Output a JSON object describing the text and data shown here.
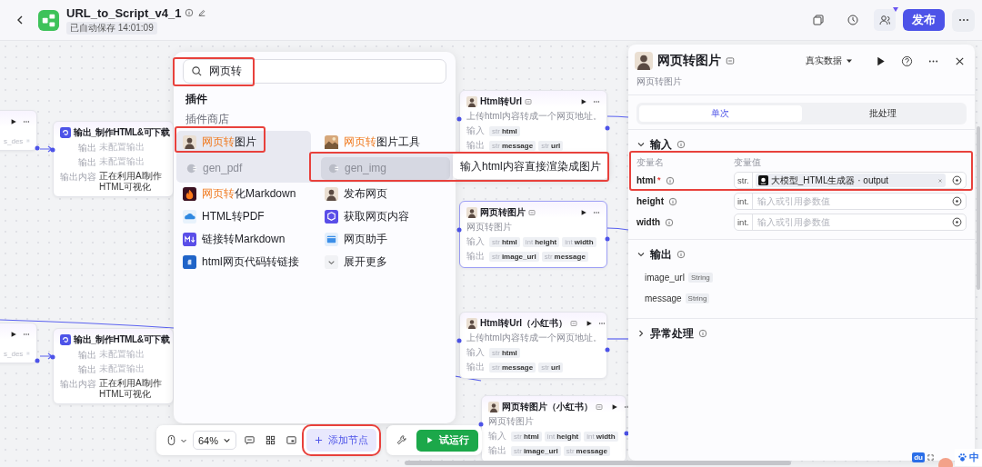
{
  "header": {
    "title": "URL_to_Script_v4_1",
    "save_status": "已自动保存 14:01:09",
    "publish_button": "发布",
    "collab_badge": true
  },
  "canvas": {
    "nodes": [
      {
        "kind": "stub",
        "field": "s_des",
        "selected": false
      },
      {
        "kind": "output",
        "title": "输出_制作HTML&可下载",
        "selected": false,
        "rows": [
          {
            "label": "输出",
            "value": "未配置输出",
            "configured": false
          },
          {
            "label": "输出",
            "value": "未配置输出",
            "configured": false
          },
          {
            "label": "输出内容",
            "value": "正在利用AI制作HTML可视化",
            "configured": true
          }
        ]
      },
      {
        "kind": "stub",
        "field": "s_des",
        "selected": false
      },
      {
        "kind": "output",
        "title": "输出_制作HTML&可下载",
        "selected": false,
        "rows": [
          {
            "label": "输出",
            "value": "未配置输出",
            "configured": false
          },
          {
            "label": "输出",
            "value": "未配置输出",
            "configured": false
          },
          {
            "label": "输出内容",
            "value": "正在利用AI制作HTML可视化",
            "configured": true
          }
        ]
      },
      {
        "kind": "plugin",
        "title": "Html转Url",
        "description": "上传html内容转成一个网页地址。",
        "selected": false,
        "input_label": "输入",
        "output_label": "输出",
        "inputs": [
          {
            "type": "str",
            "name": "html"
          }
        ],
        "outputs": [
          {
            "type": "str",
            "name": "message"
          },
          {
            "type": "str",
            "name": "url"
          }
        ]
      },
      {
        "kind": "plugin",
        "title": "网页转图片",
        "description": "网页转图片",
        "selected": true,
        "input_label": "输入",
        "output_label": "输出",
        "inputs": [
          {
            "type": "str",
            "name": "html"
          },
          {
            "type": "int",
            "name": "height"
          },
          {
            "type": "int",
            "name": "width"
          }
        ],
        "outputs": [
          {
            "type": "str",
            "name": "image_url"
          },
          {
            "type": "str",
            "name": "message"
          }
        ]
      },
      {
        "kind": "plugin",
        "title": "Html转Url（小红书）",
        "description": "上传html内容转成一个网页地址。",
        "selected": false,
        "input_label": "输入",
        "output_label": "输出",
        "inputs": [
          {
            "type": "str",
            "name": "html"
          }
        ],
        "outputs": [
          {
            "type": "str",
            "name": "message"
          },
          {
            "type": "str",
            "name": "url"
          }
        ]
      },
      {
        "kind": "plugin",
        "title": "网页转图片（小红书）",
        "description": "网页转图片",
        "selected": false,
        "input_label": "输入",
        "output_label": "输出",
        "inputs": [
          {
            "type": "str",
            "name": "html"
          },
          {
            "type": "int",
            "name": "height"
          },
          {
            "type": "int",
            "name": "width"
          }
        ],
        "outputs": [
          {
            "type": "str",
            "name": "image_url"
          },
          {
            "type": "str",
            "name": "message"
          }
        ]
      }
    ]
  },
  "node_picker": {
    "search": {
      "value": "网页转"
    },
    "section_title": "插件",
    "store_title": "插件商店",
    "rows": [
      {
        "kind": "items",
        "items": [
          {
            "kind": "plugin",
            "match": "网页转",
            "rest": "图片",
            "expanded": true
          },
          {
            "kind": "plugin",
            "match": "网页转",
            "rest": "图片工具",
            "expanded": false
          }
        ]
      },
      {
        "kind": "tools",
        "items": [
          {
            "kind": "tool",
            "label": "gen_pdf",
            "hovered": false
          },
          {
            "kind": "tool",
            "label": "gen_img",
            "hovered": true,
            "tooltip": "输入html内容直接渲染成图片"
          }
        ]
      },
      {
        "kind": "items",
        "items": [
          {
            "kind": "plugin",
            "match": "网页转",
            "rest": "化Markdown",
            "expanded": false
          },
          {
            "kind": "plugin",
            "rest": "发布网页",
            "expanded": false
          }
        ]
      },
      {
        "kind": "items",
        "items": [
          {
            "kind": "plugin",
            "rest": "HTML转PDF",
            "expanded": false
          },
          {
            "kind": "plugin",
            "rest": "获取网页内容",
            "expanded": false
          }
        ]
      },
      {
        "kind": "items",
        "items": [
          {
            "kind": "plugin",
            "rest": "链接转Markdown",
            "expanded": false
          },
          {
            "kind": "plugin",
            "rest": "网页助手",
            "expanded": false
          }
        ]
      },
      {
        "kind": "items",
        "items": [
          {
            "kind": "plugin",
            "rest": "html网页代码转链接",
            "expanded": false
          },
          {
            "kind": "more",
            "label": "展开更多"
          }
        ]
      }
    ]
  },
  "toolbar": {
    "zoom": "64%",
    "add_node_button": "添加节点",
    "test_run_button": "试运行"
  },
  "panel": {
    "title": "网页转图片",
    "subtitle": "网页转图片",
    "data_mode": "真实数据",
    "tabs": [
      {
        "label": "单次",
        "selected": true
      },
      {
        "label": "批处理",
        "selected": false
      }
    ],
    "input_section": {
      "title": "输入",
      "expanded": true,
      "name_header": "变量名",
      "value_header": "变量值",
      "params": [
        {
          "name": "html",
          "required_mark": "*",
          "type": "str.",
          "kind": "reference",
          "value": "大模型_HTML生成器 · output"
        },
        {
          "name": "height",
          "type": "int.",
          "kind": "empty",
          "placeholder": "输入或引用参数值"
        },
        {
          "name": "width",
          "type": "int.",
          "kind": "empty",
          "placeholder": "输入或引用参数值"
        }
      ]
    },
    "output_section": {
      "title": "输出",
      "expanded": true,
      "fields": [
        {
          "name": "image_url",
          "type": "String"
        },
        {
          "name": "message",
          "type": "String"
        }
      ]
    },
    "error_section": {
      "title": "异常处理",
      "expanded": false
    }
  },
  "ime": {
    "logo": "du",
    "mode": "中"
  }
}
